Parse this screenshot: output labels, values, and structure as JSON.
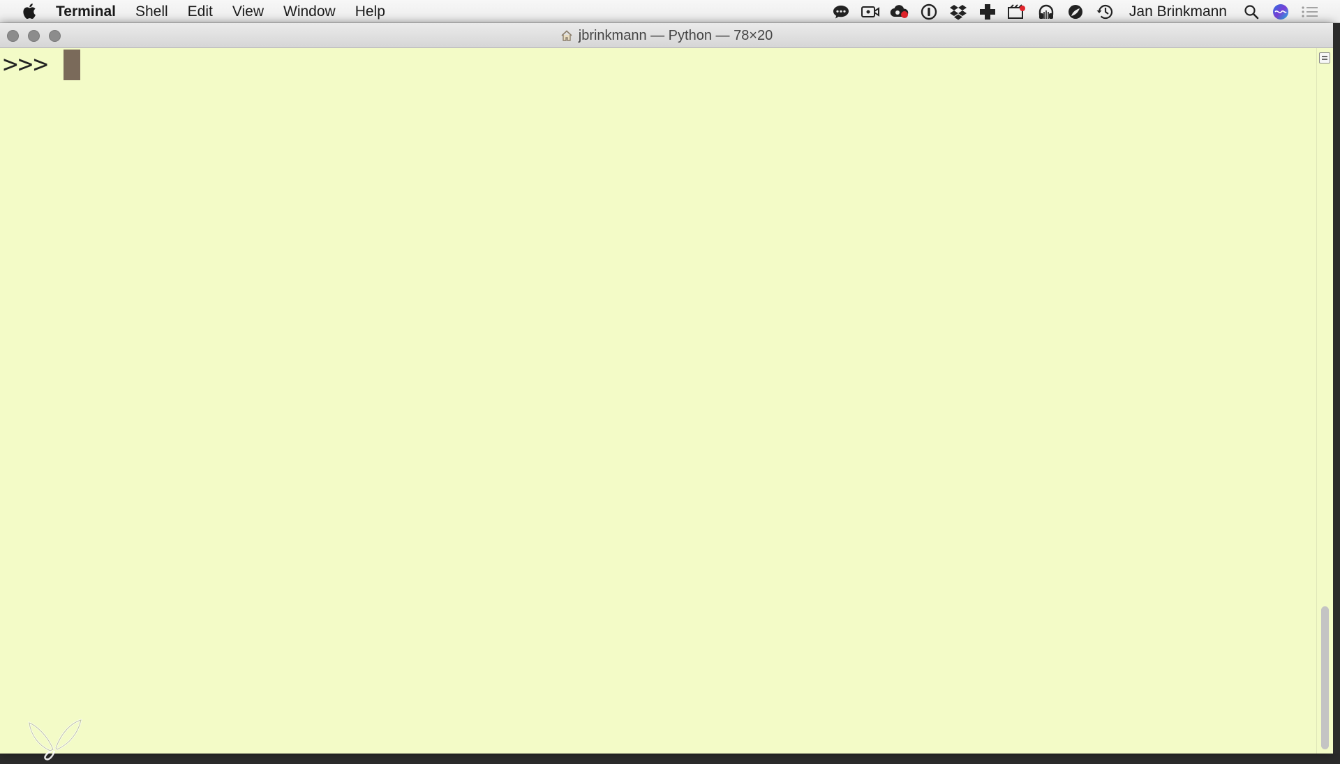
{
  "menubar": {
    "apple_icon": "apple-logo-icon",
    "app_name": "Terminal",
    "menus": [
      "Shell",
      "Edit",
      "View",
      "Window",
      "Help"
    ],
    "status_icons": [
      "chat-bubble-icon",
      "video-camera-icon",
      "creative-cloud-icon",
      "onepassword-icon",
      "dropbox-icon",
      "plus-cross-icon",
      "screen-record-icon",
      "headphones-icon",
      "leaf-icon",
      "time-machine-icon"
    ],
    "user_name": "Jan Brinkmann",
    "spotlight_icon": "search-icon",
    "siri_icon": "siri-icon",
    "notification_icon": "list-icon"
  },
  "window": {
    "title": "jbrinkmann — Python — 78×20",
    "home_icon": "home-folder-icon"
  },
  "terminal": {
    "prompt": ">>>"
  },
  "colors": {
    "terminal_background": "#f3fbc7",
    "cursor": "#7a6a5a",
    "menubar": "#ececec"
  }
}
